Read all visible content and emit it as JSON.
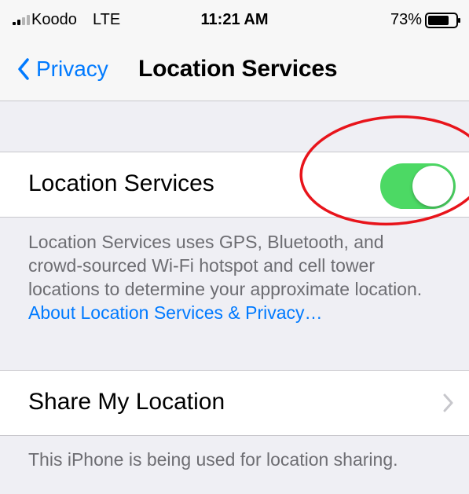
{
  "status_bar": {
    "carrier": "Koodo",
    "network": "LTE",
    "time": "11:21 AM",
    "battery_percent": "73%",
    "signal_icon": "signal-bars-icon",
    "battery_icon": "battery-icon"
  },
  "nav": {
    "back_label": "Privacy",
    "title": "Location Services"
  },
  "location_services": {
    "label": "Location Services",
    "toggle_on": true,
    "toggle_color": "#4cd964"
  },
  "description": {
    "text": "Location Services uses GPS, Bluetooth, and crowd-sourced Wi-Fi hotspot and cell tower locations to determine your approximate location. ",
    "link": "About Location Services & Privacy…"
  },
  "share_location": {
    "label": "Share My Location"
  },
  "share_footer": "This iPhone is being used for location sharing.",
  "colors": {
    "accent": "#007aff",
    "annotation": "#e8141b"
  }
}
